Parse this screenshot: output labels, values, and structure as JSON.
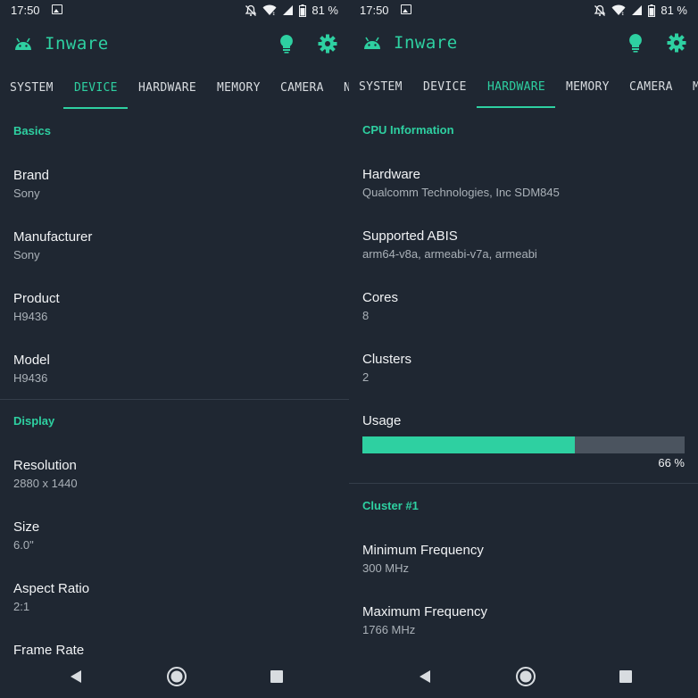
{
  "status_bar": {
    "time": "17:50",
    "battery": "81 %"
  },
  "app": {
    "title": "Inware"
  },
  "left": {
    "tabs": [
      "SYSTEM",
      "DEVICE",
      "HARDWARE",
      "MEMORY",
      "CAMERA",
      "N"
    ],
    "active_tab": "DEVICE",
    "sections": [
      {
        "title": "Basics",
        "rows": [
          {
            "label": "Brand",
            "value": "Sony"
          },
          {
            "label": "Manufacturer",
            "value": "Sony"
          },
          {
            "label": "Product",
            "value": "H9436"
          },
          {
            "label": "Model",
            "value": "H9436"
          }
        ]
      },
      {
        "title": "Display",
        "rows": [
          {
            "label": "Resolution",
            "value": "2880 x 1440"
          },
          {
            "label": "Size",
            "value": "6.0\""
          },
          {
            "label": "Aspect Ratio",
            "value": "2:1"
          },
          {
            "label": "Frame Rate",
            "value": ""
          }
        ]
      }
    ]
  },
  "right": {
    "tabs": [
      "SYSTEM",
      "DEVICE",
      "HARDWARE",
      "MEMORY",
      "CAMERA",
      "M"
    ],
    "active_tab": "HARDWARE",
    "sections": [
      {
        "title": "CPU Information",
        "rows": [
          {
            "label": "Hardware",
            "value": "Qualcomm Technologies, Inc SDM845"
          },
          {
            "label": "Supported ABIS",
            "value": "arm64-v8a, armeabi-v7a, armeabi"
          },
          {
            "label": "Cores",
            "value": "8"
          },
          {
            "label": "Clusters",
            "value": "2"
          }
        ]
      },
      {
        "title": "Cluster #1",
        "rows": [
          {
            "label": "Minimum Frequency",
            "value": "300 MHz"
          },
          {
            "label": "Maximum Frequency",
            "value": "1766 MHz"
          }
        ]
      }
    ],
    "usage": {
      "label": "Usage",
      "percent_text": "66 %",
      "fraction": 0.66
    }
  },
  "colors": {
    "accent": "#2ed0a1",
    "background": "#1f2732",
    "divider": "#343e4a",
    "bar_track": "#4b545f"
  },
  "icons": [
    "android-icon",
    "lightbulb-icon",
    "gear-icon",
    "gallery-icon",
    "do-not-disturb-icon",
    "wifi-icon",
    "signal-icon",
    "battery-icon",
    "back-icon",
    "home-icon",
    "recents-icon"
  ]
}
